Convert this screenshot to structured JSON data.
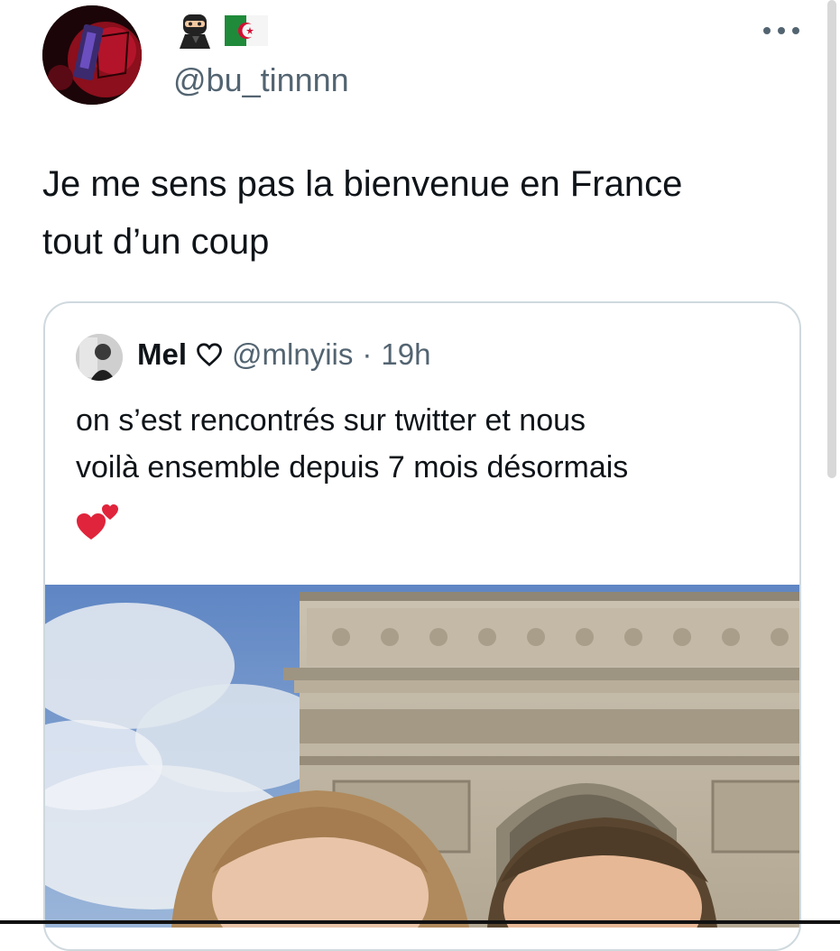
{
  "tweet": {
    "author_handle": "@bu_tinnnn",
    "author_emojis": [
      "ninja-emoji",
      "algeria-flag-emoji"
    ],
    "text": "Je me sens pas la bienvenue en France\ntout d’un coup",
    "more_label": "•••"
  },
  "quoted_tweet": {
    "name": "Mel",
    "name_icon": "heart-outline-icon",
    "handle": "@mlnyiis",
    "separator": "·",
    "time": "19h",
    "text": "on s’est rencontrés sur twitter et nous\nvoilà ensemble depuis 7 mois désormais",
    "emoji": "two-hearts-emoji",
    "photo": "arc-de-triomphe-selfie-photo"
  },
  "colors": {
    "text_primary": "#0f1419",
    "text_secondary": "#536471",
    "card_border": "#cfd9de",
    "heart_red": "#e0243b"
  }
}
